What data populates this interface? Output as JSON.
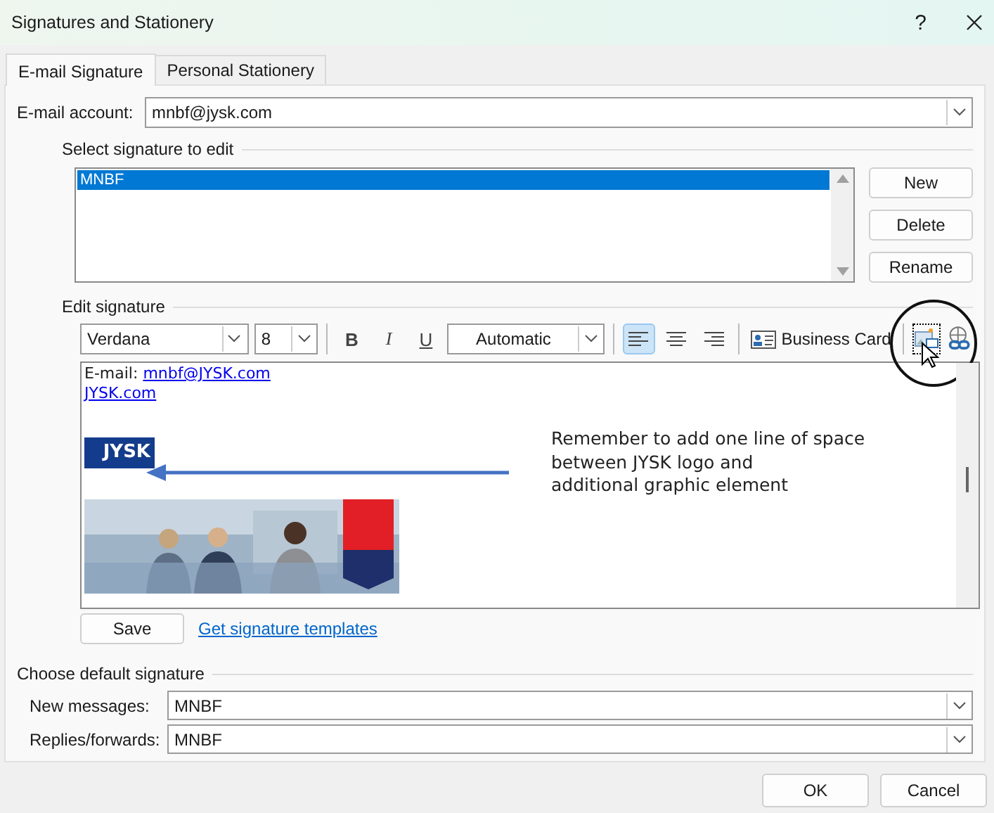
{
  "window": {
    "title": "Signatures and Stationery",
    "help": "?"
  },
  "tabs": [
    {
      "label": "E-mail Signature",
      "selected": true
    },
    {
      "label": "Personal Stationery",
      "selected": false
    }
  ],
  "email_account": {
    "label": "E-mail account:",
    "value": "mnbf@jysk.com"
  },
  "select_signature": {
    "heading": "Select signature to edit",
    "items": [
      {
        "label": "MNBF",
        "selected": true
      }
    ],
    "buttons": [
      "New",
      "Delete",
      "Rename"
    ]
  },
  "edit_signature": {
    "heading": "Edit signature",
    "toolbar": {
      "font": "Verdana",
      "size": "8",
      "formatting": [
        "B",
        "I",
        "U"
      ],
      "font_color_setting": "Automatic",
      "alignments": [
        {
          "kind": "left",
          "selected": true
        },
        {
          "kind": "center",
          "selected": false
        },
        {
          "kind": "right",
          "selected": false
        }
      ],
      "business_card": "Business Card"
    },
    "content": {
      "email_label": "E-mail:",
      "email_link": "mnbf@JYSK.com",
      "site_link": "JYSK.com",
      "logo": "JYSK"
    },
    "annotation": [
      "Remember to add one line of space",
      "between JYSK logo and",
      "additional graphic element"
    ],
    "save": "Save",
    "templates_link": "Get signature templates"
  },
  "default_signature": {
    "heading": "Choose default signature",
    "rows": [
      {
        "label": "New messages:",
        "value": "MNBF"
      },
      {
        "label": "Replies/forwards:",
        "value": "MNBF"
      }
    ]
  },
  "buttons": [
    "OK",
    "Cancel"
  ]
}
